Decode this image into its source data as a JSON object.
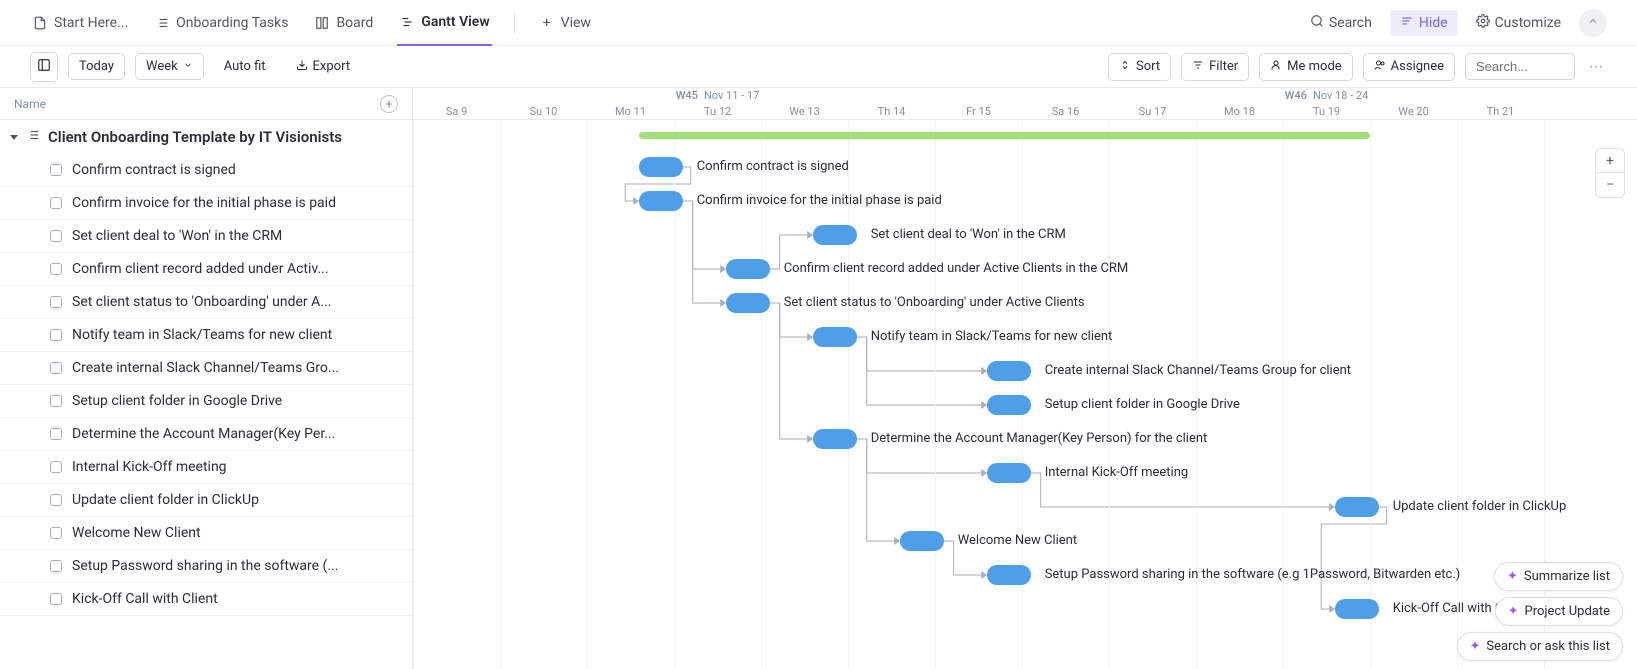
{
  "tabs": [
    {
      "label": "Start Here...",
      "icon": "doc"
    },
    {
      "label": "Onboarding Tasks",
      "icon": "list"
    },
    {
      "label": "Board",
      "icon": "board"
    },
    {
      "label": "Gantt View",
      "icon": "gantt",
      "active": true
    },
    {
      "label": "View",
      "icon": "plus"
    }
  ],
  "topActions": {
    "search": "Search",
    "hide": "Hide",
    "customize": "Customize"
  },
  "toolbar": {
    "today": "Today",
    "week": "Week",
    "autofit": "Auto fit",
    "export": "Export",
    "sort": "Sort",
    "filter": "Filter",
    "meMode": "Me mode",
    "assignee": "Assignee",
    "searchPlaceholder": "Search..."
  },
  "panel": {
    "column": "Name",
    "groupTitle": "Client Onboarding Template by IT Visionists"
  },
  "tasks": [
    {
      "name": "Confirm contract is signed"
    },
    {
      "name": "Confirm invoice for the initial phase is paid"
    },
    {
      "name": "Set client deal to 'Won' in the CRM"
    },
    {
      "name": "Confirm client record added under Activ..."
    },
    {
      "name": "Set client status to 'Onboarding' under A..."
    },
    {
      "name": "Notify team in Slack/Teams for new client"
    },
    {
      "name": "Create internal Slack Channel/Teams Gro..."
    },
    {
      "name": "Setup client folder in Google Drive"
    },
    {
      "name": "Determine the Account Manager(Key Per..."
    },
    {
      "name": "Internal Kick-Off meeting"
    },
    {
      "name": "Update client folder in ClickUp"
    },
    {
      "name": "Welcome New Client"
    },
    {
      "name": "Setup Password sharing in the software (..."
    },
    {
      "name": "Kick-Off Call with Client"
    }
  ],
  "timeline": {
    "weeks": [
      {
        "label": "W45",
        "range": "Nov 11 - 17",
        "startCol": 0,
        "span": 7
      },
      {
        "label": "W46",
        "range": "Nov 18 - 24",
        "startCol": 7,
        "span": 7
      }
    ],
    "days": [
      {
        "d": "Sa",
        "n": "9"
      },
      {
        "d": "Su",
        "n": "10"
      },
      {
        "d": "Mo",
        "n": "11"
      },
      {
        "d": "Tu",
        "n": "12"
      },
      {
        "d": "We",
        "n": "13"
      },
      {
        "d": "Th",
        "n": "14"
      },
      {
        "d": "Fr",
        "n": "15"
      },
      {
        "d": "Sa",
        "n": "16"
      },
      {
        "d": "Su",
        "n": "17"
      },
      {
        "d": "Mo",
        "n": "18"
      },
      {
        "d": "Tu",
        "n": "19"
      },
      {
        "d": "We",
        "n": "20"
      },
      {
        "d": "Th",
        "n": "21"
      }
    ],
    "dayWidthPx": 87,
    "summary": {
      "startCol": 2.6,
      "endCol": 11.0
    }
  },
  "bars": [
    {
      "row": 0,
      "startCol": 2.6,
      "span": 0.5,
      "label": "Confirm contract is signed"
    },
    {
      "row": 1,
      "startCol": 2.6,
      "span": 0.5,
      "label": "Confirm invoice for the initial phase is paid"
    },
    {
      "row": 2,
      "startCol": 4.6,
      "span": 0.5,
      "label": "Set client deal to 'Won' in the CRM"
    },
    {
      "row": 3,
      "startCol": 3.6,
      "span": 0.5,
      "label": "Confirm client record added under Active Clients in the CRM"
    },
    {
      "row": 4,
      "startCol": 3.6,
      "span": 0.5,
      "label": "Set client status to 'Onboarding' under Active Clients"
    },
    {
      "row": 5,
      "startCol": 4.6,
      "span": 0.5,
      "label": "Notify team in Slack/Teams for new client"
    },
    {
      "row": 6,
      "startCol": 6.6,
      "span": 0.5,
      "label": "Create internal Slack Channel/Teams Group for client"
    },
    {
      "row": 7,
      "startCol": 6.6,
      "span": 0.5,
      "label": "Setup client folder in Google Drive"
    },
    {
      "row": 8,
      "startCol": 4.6,
      "span": 0.5,
      "label": "Determine the Account Manager(Key Person) for the client"
    },
    {
      "row": 9,
      "startCol": 6.6,
      "span": 0.5,
      "label": "Internal Kick-Off meeting"
    },
    {
      "row": 10,
      "startCol": 10.6,
      "span": 0.5,
      "label": "Update client folder in ClickUp"
    },
    {
      "row": 11,
      "startCol": 5.6,
      "span": 0.5,
      "label": "Welcome New Client"
    },
    {
      "row": 12,
      "startCol": 6.6,
      "span": 0.5,
      "label": "Setup Password sharing in the software (e.g 1Password, Bitwarden etc.)"
    },
    {
      "row": 13,
      "startCol": 10.6,
      "span": 0.5,
      "label": "Kick-Off Call with Client"
    }
  ],
  "dependencies": [
    {
      "from": 0,
      "to": 1
    },
    {
      "from": 1,
      "to": 3
    },
    {
      "from": 1,
      "to": 4
    },
    {
      "from": 3,
      "to": 2
    },
    {
      "from": 4,
      "to": 5
    },
    {
      "from": 4,
      "to": 8
    },
    {
      "from": 5,
      "to": 6
    },
    {
      "from": 5,
      "to": 7
    },
    {
      "from": 8,
      "to": 9
    },
    {
      "from": 8,
      "to": 11
    },
    {
      "from": 9,
      "to": 10
    },
    {
      "from": 11,
      "to": 12
    },
    {
      "from": 10,
      "to": 13
    }
  ],
  "ai": {
    "summarize": "Summarize list",
    "project": "Project Update",
    "ask": "Search or ask this list"
  }
}
